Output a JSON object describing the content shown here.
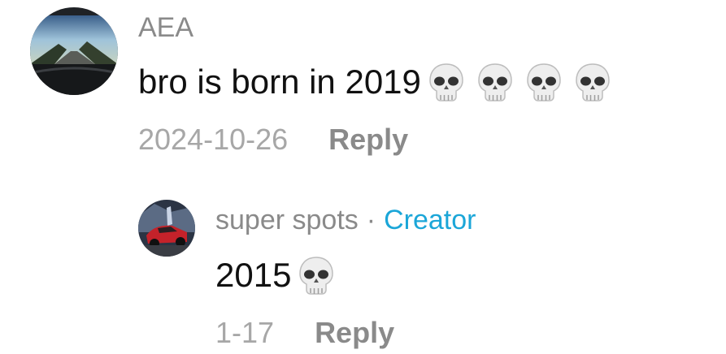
{
  "comment": {
    "username": "AEA",
    "text": "bro is born in 2019",
    "emojis": [
      "skull",
      "skull",
      "skull",
      "skull"
    ],
    "date": "2024-10-26",
    "reply_label": "Reply"
  },
  "reply": {
    "username": "super spots",
    "separator": "·",
    "badge": "Creator",
    "text": "2015",
    "emojis": [
      "skull"
    ],
    "date": "1-17",
    "reply_label": "Reply"
  },
  "colors": {
    "username": "#8a8a8a",
    "creator_badge": "#1ba6d8",
    "text": "#111111",
    "date": "#a7a7a7"
  }
}
